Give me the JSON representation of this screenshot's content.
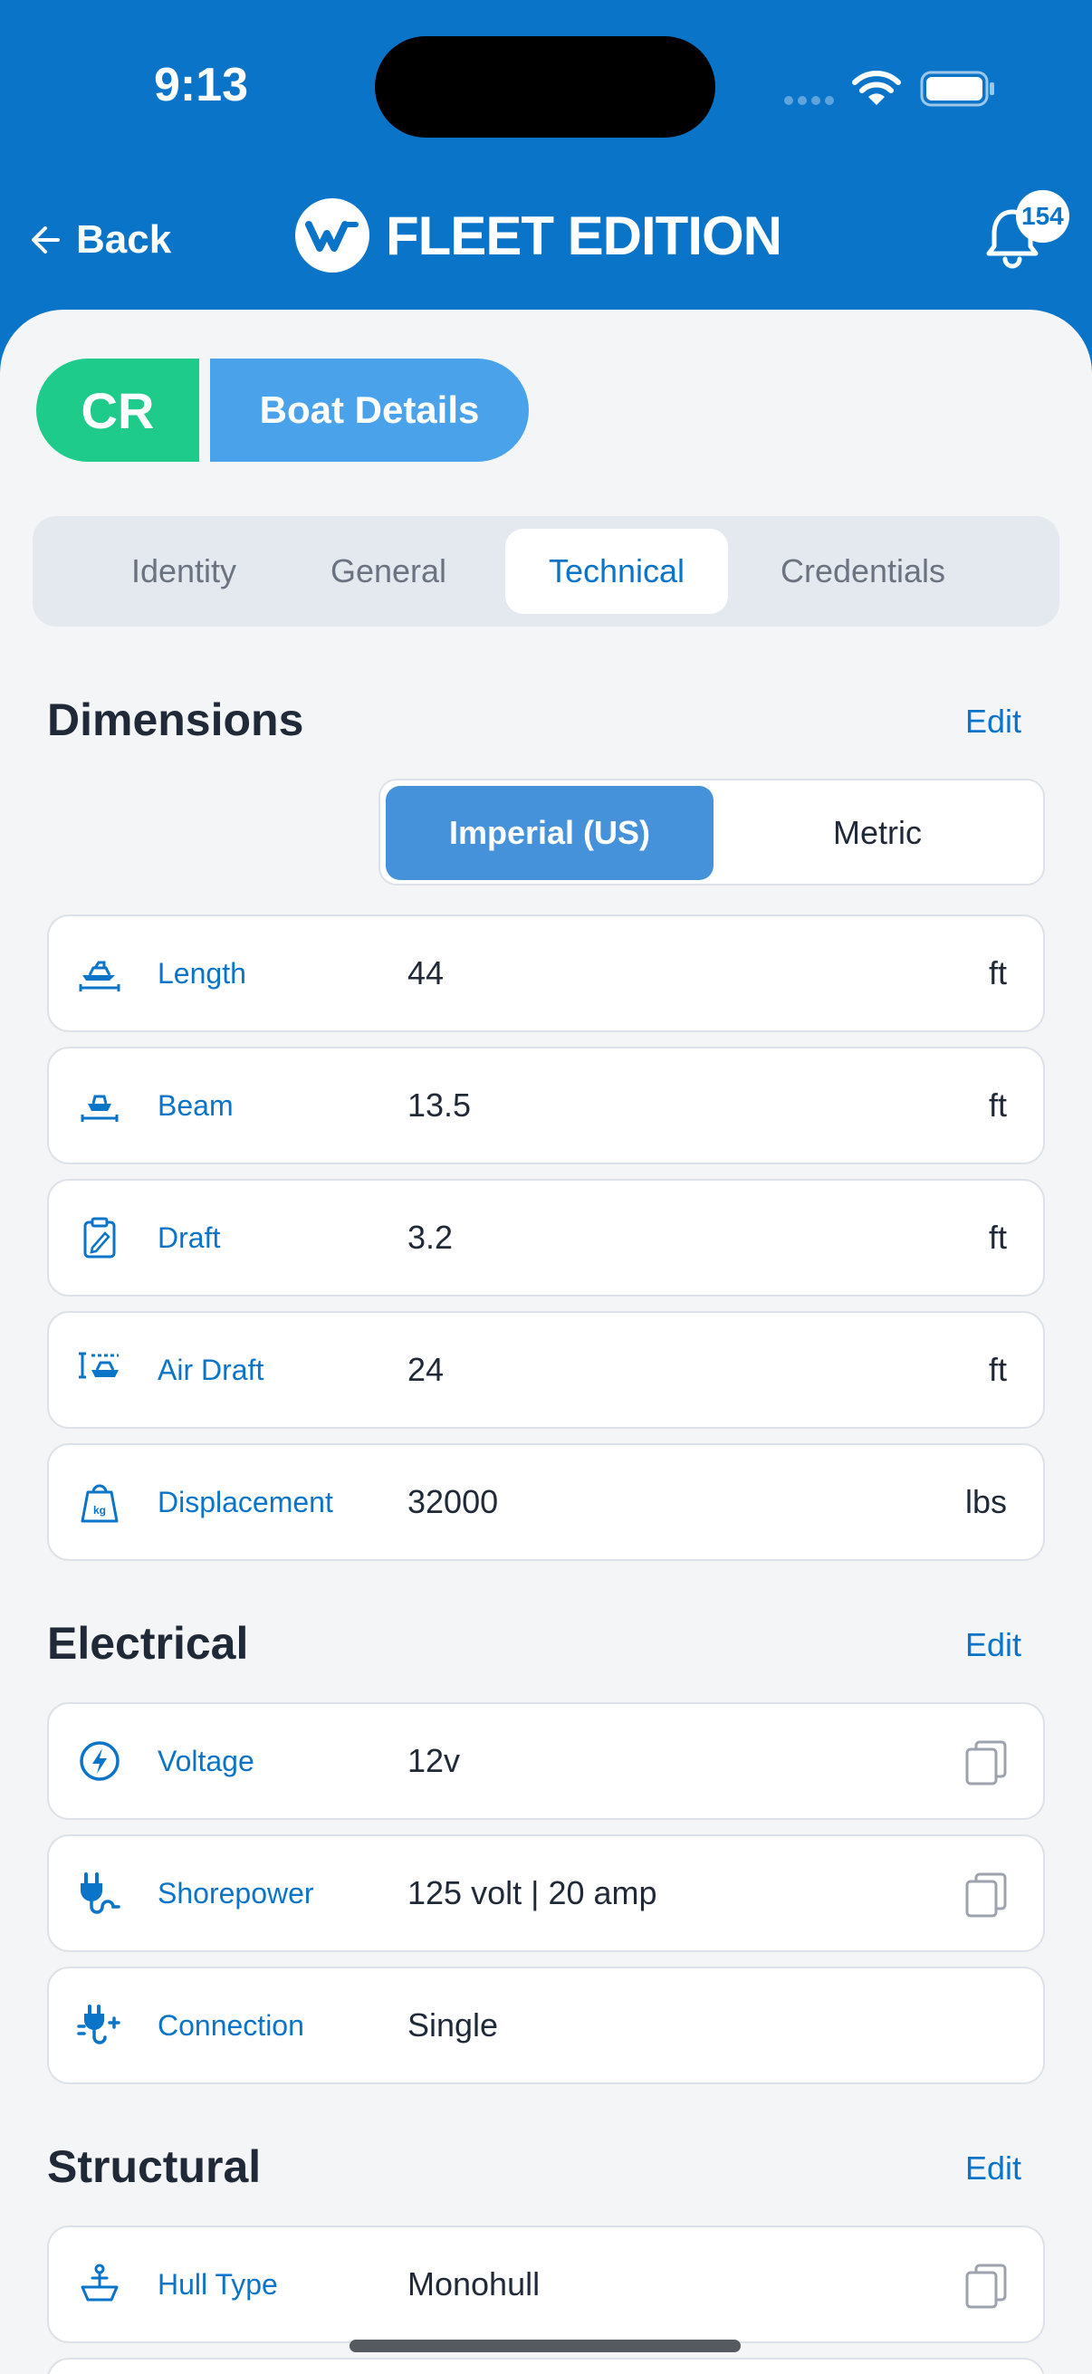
{
  "status": {
    "time": "9:13"
  },
  "nav": {
    "back_label": "Back",
    "brand": "FLEET EDITION",
    "notifications_count": "154"
  },
  "header": {
    "initials": "CR",
    "title": "Boat Details"
  },
  "tabs": [
    {
      "label": "Identity",
      "active": false
    },
    {
      "label": "General",
      "active": false
    },
    {
      "label": "Technical",
      "active": true
    },
    {
      "label": "Credentials",
      "active": false
    }
  ],
  "dimensions": {
    "title": "Dimensions",
    "edit_label": "Edit",
    "unit_options": [
      "Imperial (US)",
      "Metric"
    ],
    "selected_unit": "Imperial (US)",
    "rows": [
      {
        "icon": "boat-length-icon",
        "label": "Length",
        "value": "44",
        "unit": "ft"
      },
      {
        "icon": "boat-beam-icon",
        "label": "Beam",
        "value": "13.5",
        "unit": "ft"
      },
      {
        "icon": "clipboard-draft-icon",
        "label": "Draft",
        "value": "3.2",
        "unit": "ft"
      },
      {
        "icon": "air-draft-icon",
        "label": "Air Draft",
        "value": "24",
        "unit": "ft"
      },
      {
        "icon": "weight-kg-icon",
        "label": "Displacement",
        "value": "32000",
        "unit": "lbs"
      }
    ]
  },
  "electrical": {
    "title": "Electrical",
    "edit_label": "Edit",
    "rows": [
      {
        "icon": "lightning-icon",
        "label": "Voltage",
        "value": "12v",
        "copyable": true
      },
      {
        "icon": "plug-icon",
        "label": "Shorepower",
        "value": "125 volt | 20 amp",
        "copyable": true
      },
      {
        "icon": "double-plug-icon",
        "label": "Connection",
        "value": "Single",
        "copyable": false
      }
    ]
  },
  "structural": {
    "title": "Structural",
    "edit_label": "Edit",
    "rows": [
      {
        "icon": "hull-icon",
        "label": "Hull Type",
        "value": "Monohull",
        "copyable": true
      }
    ]
  },
  "colors": {
    "brand_blue": "#0a74c9",
    "cr_green": "#1ecb8b",
    "title_chip": "#4aa3ea",
    "selected_unit": "#4592db"
  }
}
